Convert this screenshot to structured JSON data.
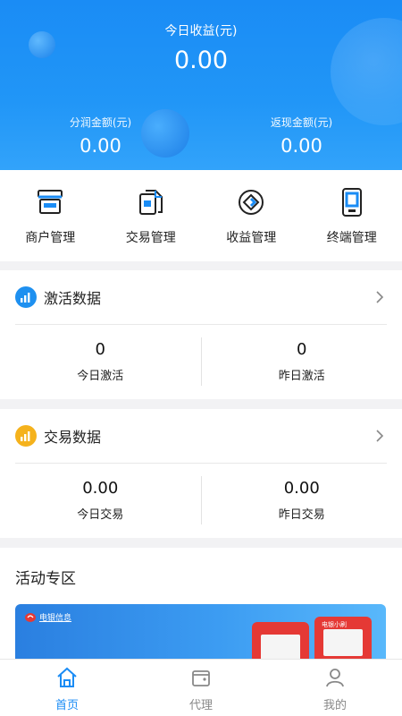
{
  "header": {
    "today_label": "今日收益(元)",
    "today_value": "0.00",
    "share_label": "分润金额(元)",
    "share_value": "0.00",
    "cashback_label": "返现金额(元)",
    "cashback_value": "0.00"
  },
  "quick_menu": [
    {
      "label": "商户管理",
      "icon": "merchant-icon"
    },
    {
      "label": "交易管理",
      "icon": "transaction-doc-icon"
    },
    {
      "label": "收益管理",
      "icon": "earnings-icon"
    },
    {
      "label": "终端管理",
      "icon": "terminal-icon"
    }
  ],
  "activation": {
    "title": "激活数据",
    "today_value": "0",
    "today_label": "今日激活",
    "yesterday_value": "0",
    "yesterday_label": "昨日激活"
  },
  "transactions": {
    "title": "交易数据",
    "today_value": "0.00",
    "today_label": "今日交易",
    "yesterday_value": "0.00",
    "yesterday_label": "昨日交易"
  },
  "activity": {
    "title": "活动专区",
    "banner_logo_text": "电银信息",
    "device_tag": "电银小刷"
  },
  "tabbar": [
    {
      "label": "首页",
      "icon": "home-icon",
      "active": true
    },
    {
      "label": "代理",
      "icon": "wallet-icon",
      "active": false
    },
    {
      "label": "我的",
      "icon": "user-icon",
      "active": false
    }
  ],
  "colors": {
    "primary": "#1a8cf5",
    "activation_icon": "#1e90f0",
    "transaction_icon": "#f5b21c"
  }
}
